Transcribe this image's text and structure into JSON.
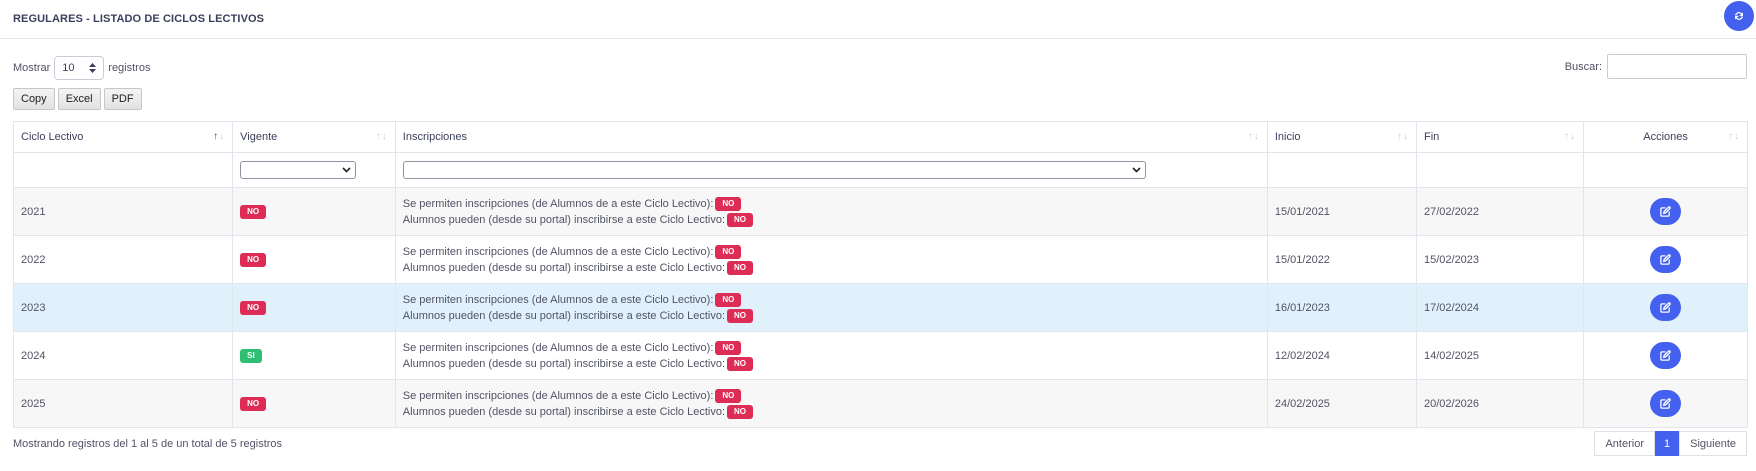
{
  "header": {
    "title": "REGULARES - LISTADO DE CICLOS LECTIVOS"
  },
  "controls": {
    "show_label": "Mostrar",
    "page_size": "10",
    "records_label": "registros",
    "search_label": "Buscar:",
    "search_value": "",
    "export_buttons": [
      "Copy",
      "Excel",
      "PDF"
    ]
  },
  "table": {
    "columns": [
      "Ciclo Lectivo",
      "Vigente",
      "Inscripciones",
      "Inicio",
      "Fin",
      "Acciones"
    ],
    "inscripcion_label_1": "Se permiten inscripciones (de Alumnos de a este Ciclo Lectivo):",
    "inscripcion_label_2": "Alumnos pueden (desde su portal) inscribirse a este Ciclo Lectivo:",
    "rows": [
      {
        "ciclo": "2021",
        "vigente": "NO",
        "insc1": "NO",
        "insc2": "NO",
        "inicio": "15/01/2021",
        "fin": "27/02/2022"
      },
      {
        "ciclo": "2022",
        "vigente": "NO",
        "insc1": "NO",
        "insc2": "NO",
        "inicio": "15/01/2022",
        "fin": "15/02/2023"
      },
      {
        "ciclo": "2023",
        "vigente": "NO",
        "insc1": "NO",
        "insc2": "NO",
        "inicio": "16/01/2023",
        "fin": "17/02/2024"
      },
      {
        "ciclo": "2024",
        "vigente": "SI",
        "insc1": "NO",
        "insc2": "NO",
        "inicio": "12/02/2024",
        "fin": "14/02/2025"
      },
      {
        "ciclo": "2025",
        "vigente": "NO",
        "insc1": "NO",
        "insc2": "NO",
        "inicio": "24/02/2025",
        "fin": "20/02/2026"
      }
    ]
  },
  "footer": {
    "info": "Mostrando registros del 1 al 5 de un total de 5 registros",
    "prev": "Anterior",
    "current_page": "1",
    "next": "Siguiente"
  },
  "colors": {
    "accent": "#4361ee",
    "badge_no": "#dd2c55",
    "badge_si": "#2ebf73",
    "row_highlight": "#e0f1fc"
  },
  "icons": {
    "refresh": "refresh-icon",
    "edit": "edit-icon",
    "chevron": "chevron-down-icon",
    "sort": "sort-arrows-icon"
  }
}
